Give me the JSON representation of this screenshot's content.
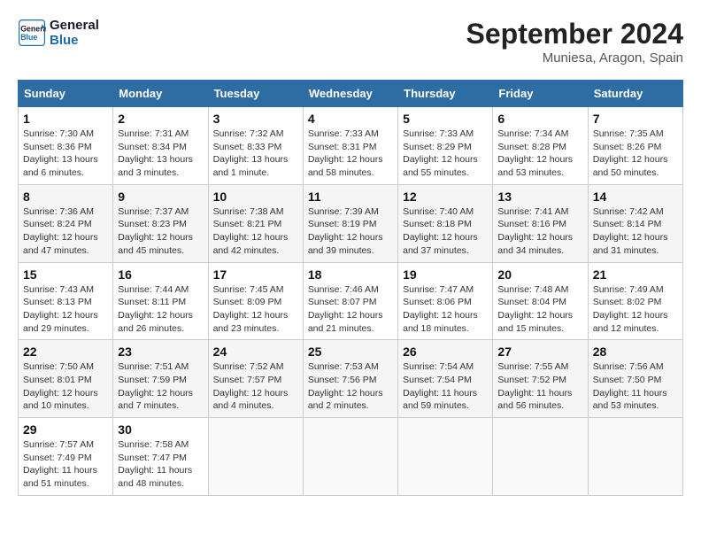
{
  "header": {
    "logo_line1": "General",
    "logo_line2": "Blue",
    "month_title": "September 2024",
    "location": "Muniesa, Aragon, Spain"
  },
  "weekdays": [
    "Sunday",
    "Monday",
    "Tuesday",
    "Wednesday",
    "Thursday",
    "Friday",
    "Saturday"
  ],
  "weeks": [
    [
      {
        "day": "1",
        "sunrise": "Sunrise: 7:30 AM",
        "sunset": "Sunset: 8:36 PM",
        "daylight": "Daylight: 13 hours and 6 minutes."
      },
      {
        "day": "2",
        "sunrise": "Sunrise: 7:31 AM",
        "sunset": "Sunset: 8:34 PM",
        "daylight": "Daylight: 13 hours and 3 minutes."
      },
      {
        "day": "3",
        "sunrise": "Sunrise: 7:32 AM",
        "sunset": "Sunset: 8:33 PM",
        "daylight": "Daylight: 13 hours and 1 minute."
      },
      {
        "day": "4",
        "sunrise": "Sunrise: 7:33 AM",
        "sunset": "Sunset: 8:31 PM",
        "daylight": "Daylight: 12 hours and 58 minutes."
      },
      {
        "day": "5",
        "sunrise": "Sunrise: 7:33 AM",
        "sunset": "Sunset: 8:29 PM",
        "daylight": "Daylight: 12 hours and 55 minutes."
      },
      {
        "day": "6",
        "sunrise": "Sunrise: 7:34 AM",
        "sunset": "Sunset: 8:28 PM",
        "daylight": "Daylight: 12 hours and 53 minutes."
      },
      {
        "day": "7",
        "sunrise": "Sunrise: 7:35 AM",
        "sunset": "Sunset: 8:26 PM",
        "daylight": "Daylight: 12 hours and 50 minutes."
      }
    ],
    [
      {
        "day": "8",
        "sunrise": "Sunrise: 7:36 AM",
        "sunset": "Sunset: 8:24 PM",
        "daylight": "Daylight: 12 hours and 47 minutes."
      },
      {
        "day": "9",
        "sunrise": "Sunrise: 7:37 AM",
        "sunset": "Sunset: 8:23 PM",
        "daylight": "Daylight: 12 hours and 45 minutes."
      },
      {
        "day": "10",
        "sunrise": "Sunrise: 7:38 AM",
        "sunset": "Sunset: 8:21 PM",
        "daylight": "Daylight: 12 hours and 42 minutes."
      },
      {
        "day": "11",
        "sunrise": "Sunrise: 7:39 AM",
        "sunset": "Sunset: 8:19 PM",
        "daylight": "Daylight: 12 hours and 39 minutes."
      },
      {
        "day": "12",
        "sunrise": "Sunrise: 7:40 AM",
        "sunset": "Sunset: 8:18 PM",
        "daylight": "Daylight: 12 hours and 37 minutes."
      },
      {
        "day": "13",
        "sunrise": "Sunrise: 7:41 AM",
        "sunset": "Sunset: 8:16 PM",
        "daylight": "Daylight: 12 hours and 34 minutes."
      },
      {
        "day": "14",
        "sunrise": "Sunrise: 7:42 AM",
        "sunset": "Sunset: 8:14 PM",
        "daylight": "Daylight: 12 hours and 31 minutes."
      }
    ],
    [
      {
        "day": "15",
        "sunrise": "Sunrise: 7:43 AM",
        "sunset": "Sunset: 8:13 PM",
        "daylight": "Daylight: 12 hours and 29 minutes."
      },
      {
        "day": "16",
        "sunrise": "Sunrise: 7:44 AM",
        "sunset": "Sunset: 8:11 PM",
        "daylight": "Daylight: 12 hours and 26 minutes."
      },
      {
        "day": "17",
        "sunrise": "Sunrise: 7:45 AM",
        "sunset": "Sunset: 8:09 PM",
        "daylight": "Daylight: 12 hours and 23 minutes."
      },
      {
        "day": "18",
        "sunrise": "Sunrise: 7:46 AM",
        "sunset": "Sunset: 8:07 PM",
        "daylight": "Daylight: 12 hours and 21 minutes."
      },
      {
        "day": "19",
        "sunrise": "Sunrise: 7:47 AM",
        "sunset": "Sunset: 8:06 PM",
        "daylight": "Daylight: 12 hours and 18 minutes."
      },
      {
        "day": "20",
        "sunrise": "Sunrise: 7:48 AM",
        "sunset": "Sunset: 8:04 PM",
        "daylight": "Daylight: 12 hours and 15 minutes."
      },
      {
        "day": "21",
        "sunrise": "Sunrise: 7:49 AM",
        "sunset": "Sunset: 8:02 PM",
        "daylight": "Daylight: 12 hours and 12 minutes."
      }
    ],
    [
      {
        "day": "22",
        "sunrise": "Sunrise: 7:50 AM",
        "sunset": "Sunset: 8:01 PM",
        "daylight": "Daylight: 12 hours and 10 minutes."
      },
      {
        "day": "23",
        "sunrise": "Sunrise: 7:51 AM",
        "sunset": "Sunset: 7:59 PM",
        "daylight": "Daylight: 12 hours and 7 minutes."
      },
      {
        "day": "24",
        "sunrise": "Sunrise: 7:52 AM",
        "sunset": "Sunset: 7:57 PM",
        "daylight": "Daylight: 12 hours and 4 minutes."
      },
      {
        "day": "25",
        "sunrise": "Sunrise: 7:53 AM",
        "sunset": "Sunset: 7:56 PM",
        "daylight": "Daylight: 12 hours and 2 minutes."
      },
      {
        "day": "26",
        "sunrise": "Sunrise: 7:54 AM",
        "sunset": "Sunset: 7:54 PM",
        "daylight": "Daylight: 11 hours and 59 minutes."
      },
      {
        "day": "27",
        "sunrise": "Sunrise: 7:55 AM",
        "sunset": "Sunset: 7:52 PM",
        "daylight": "Daylight: 11 hours and 56 minutes."
      },
      {
        "day": "28",
        "sunrise": "Sunrise: 7:56 AM",
        "sunset": "Sunset: 7:50 PM",
        "daylight": "Daylight: 11 hours and 53 minutes."
      }
    ],
    [
      {
        "day": "29",
        "sunrise": "Sunrise: 7:57 AM",
        "sunset": "Sunset: 7:49 PM",
        "daylight": "Daylight: 11 hours and 51 minutes."
      },
      {
        "day": "30",
        "sunrise": "Sunrise: 7:58 AM",
        "sunset": "Sunset: 7:47 PM",
        "daylight": "Daylight: 11 hours and 48 minutes."
      },
      null,
      null,
      null,
      null,
      null
    ]
  ]
}
